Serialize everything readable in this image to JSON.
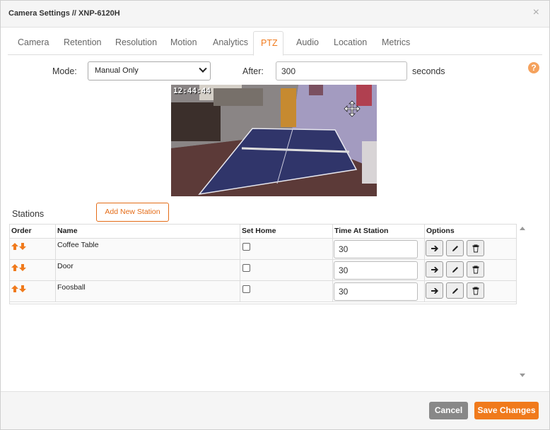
{
  "dialog": {
    "title": "Camera Settings // XNP-6120H",
    "close_label": "×"
  },
  "tabs": [
    {
      "label": "Camera"
    },
    {
      "label": "Retention"
    },
    {
      "label": "Resolution"
    },
    {
      "label": "Motion"
    },
    {
      "label": "Analytics"
    },
    {
      "label": "PTZ",
      "active": true
    },
    {
      "label": "Audio"
    },
    {
      "label": "Location"
    },
    {
      "label": "Metrics"
    }
  ],
  "ptz": {
    "mode_label": "Mode:",
    "mode_value": "Manual Only",
    "after_label": "After:",
    "after_value": "300",
    "after_unit": "seconds",
    "help_label": "?",
    "timestamp": "12:44:44"
  },
  "stations": {
    "label": "Stations",
    "add_button": "Add New Station",
    "columns": [
      "Order",
      "Name",
      "Set Home",
      "Time At Station",
      "Options"
    ],
    "rows": [
      {
        "name": "Coffee Table",
        "set_home": false,
        "time": "30"
      },
      {
        "name": "Door",
        "set_home": false,
        "time": "30"
      },
      {
        "name": "Foosball",
        "set_home": false,
        "time": "30"
      }
    ]
  },
  "footer": {
    "cancel": "Cancel",
    "save": "Save Changes"
  },
  "colors": {
    "accent": "#f07a1c",
    "cancel": "#888888"
  }
}
